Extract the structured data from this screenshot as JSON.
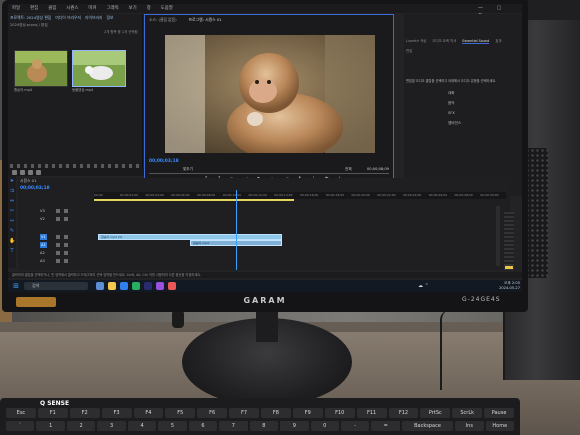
{
  "app": {
    "menu": [
      "파일",
      "편집",
      "클립",
      "시퀀스",
      "마커",
      "그래픽",
      "보기",
      "창",
      "도움말"
    ],
    "window_title": "",
    "project_tabs": [
      "프로젝트: 2024영상 편집",
      "미디어 브라우저",
      "라이브러리",
      "정보"
    ],
    "project_path": "2024영상.prproj / 편집",
    "project_count": "2개 항목 중 1개 선택됨",
    "thumb_captions": [
      "원숭이.mp4",
      "동물영상.mp4"
    ],
    "program_tabs": [
      "소스: (클립 없음)",
      "프로그램: 시퀀스 01"
    ],
    "timecode_left": "00;00;03;18",
    "timecode_right": "00;00;08;09",
    "fit": "맞추기",
    "full": "전체",
    "effects_tabs": [
      "Lumetri 색상",
      "오디오 트랙 믹서",
      "Essential Sound",
      "효과"
    ],
    "effects_sub": "편집",
    "effects_message": "편집할 오디오 클립을 선택하고 아래에서 오디오 유형을 선택하세요.",
    "effects_buttons": [
      "대화",
      "음악",
      "SFX",
      "앰비언스"
    ],
    "sequence_tab": "시퀀스 01",
    "sequence_tc": "00;00;03;18",
    "ruler_labels": [
      "00;00",
      "00;00;02;00",
      "00;00;04;00",
      "00;00;06;00",
      "00;00;08;00",
      "00;00;10;00",
      "00;00;12;00",
      "00;00;14;00",
      "00;00;16;00",
      "00;00;18;00",
      "00;00;20;00",
      "00;00;22;00",
      "00;00;24;00",
      "00;00;26;00",
      "00;00;28;00",
      "00;00;30;00"
    ],
    "tracks": [
      "V3",
      "V2",
      "V1",
      "A1",
      "A2",
      "A3"
    ],
    "clip_video": "원숭이.mp4 [V]",
    "clip_audio": "원숭이.mp4",
    "status": "클릭하여 클립을 선택하거나, 빈 영역에서 클릭하고 드래그하여 선택 영역을 만드세요. Shift, Alt, Ctrl 키를 사용하여 다른 옵션을 지정하세요.",
    "search": "검색",
    "clock_time": "오후 2:05",
    "clock_date": "2024-05-27"
  },
  "hardware": {
    "monitor_brand": "GARAM",
    "monitor_model": "G-24GE4S",
    "keyboard_brand": "Q SENSE"
  },
  "keyboard_rows": [
    [
      "Esc",
      "F1",
      "F2",
      "F3",
      "F4",
      "F5",
      "F6",
      "F7",
      "F8",
      "F9",
      "F10",
      "F11",
      "F12",
      "PrtSc",
      "ScrLk",
      "Pause"
    ],
    [
      "`",
      "1",
      "2",
      "3",
      "4",
      "5",
      "6",
      "7",
      "8",
      "9",
      "0",
      "-",
      "=",
      "Backspace",
      "Ins",
      "Home"
    ]
  ],
  "colors": {
    "accent": "#3d6ad6",
    "timecode": "#3a8dff",
    "clip": "#8fc7e8",
    "workarea": "#e7d45a"
  }
}
